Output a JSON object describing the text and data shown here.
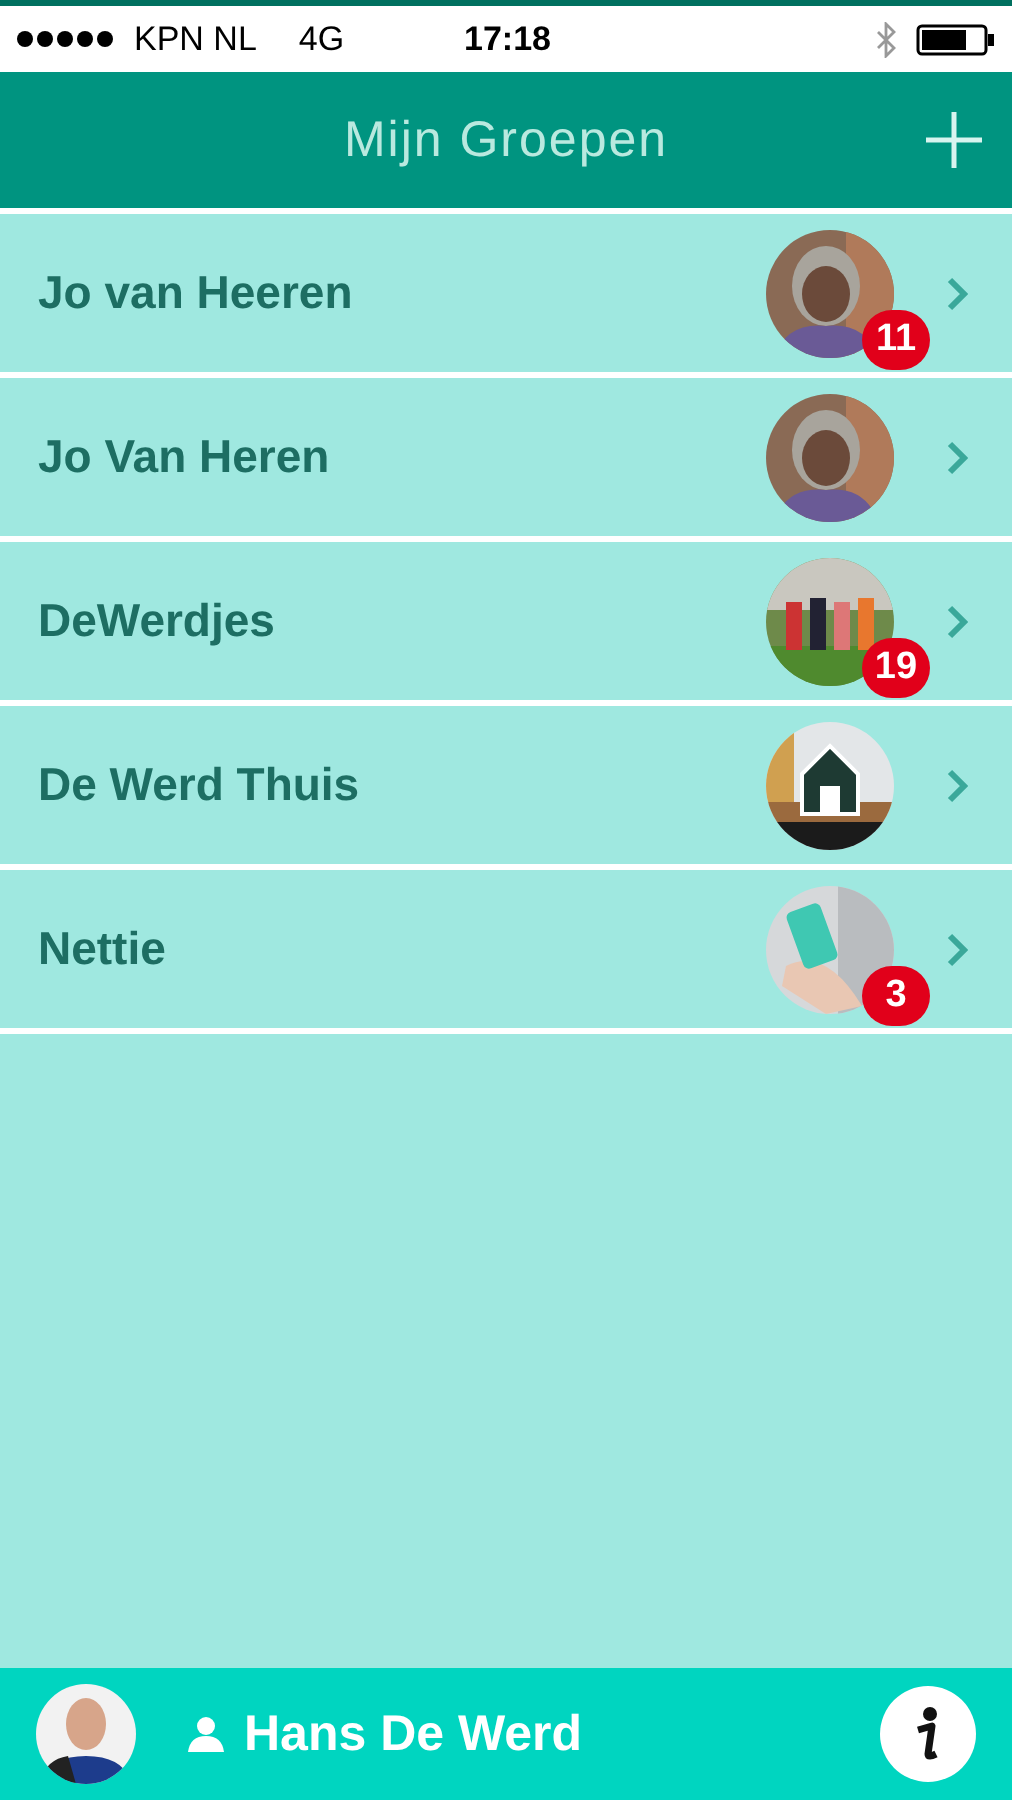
{
  "status_bar": {
    "carrier": "KPN NL",
    "network": "4G",
    "time": "17:18"
  },
  "header": {
    "title": "Mijn Groepen"
  },
  "groups": [
    {
      "name": "Jo van Heeren",
      "badge": "11"
    },
    {
      "name": "Jo Van Heren"
    },
    {
      "name": "DeWerdjes",
      "badge": "19"
    },
    {
      "name": "De Werd Thuis"
    },
    {
      "name": "Nettie",
      "badge": "3"
    }
  ],
  "footer": {
    "user": "Hans De Werd"
  }
}
